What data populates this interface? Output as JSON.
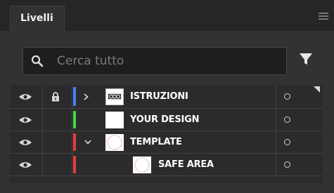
{
  "panel": {
    "tab_label": "Livelli",
    "menu_icon": "hamburger-icon"
  },
  "search": {
    "placeholder": "Cerca tutto",
    "value": "",
    "icon": "search-icon",
    "filter_icon": "filter-icon"
  },
  "layers": [
    {
      "name": "ISTRUZIONI",
      "color": "#4a7dff",
      "visible": true,
      "locked": true,
      "expanded": false,
      "depth": 0,
      "thumbnail": "instructions-thumbnail"
    },
    {
      "name": "YOUR DESIGN",
      "color": "#3ddc3d",
      "visible": true,
      "locked": false,
      "depth": 0,
      "thumbnail": "blank-thumbnail"
    },
    {
      "name": "TEMPLATE",
      "color": "#e53b3b",
      "visible": true,
      "locked": false,
      "expanded": true,
      "depth": 0,
      "thumbnail": "circle-thumbnail"
    },
    {
      "name": "SAFE AREA",
      "color": "#e53b3b",
      "visible": true,
      "locked": false,
      "depth": 1,
      "thumbnail": "circle-thumbnail"
    }
  ],
  "icons": {
    "visibility": "eye-icon",
    "lock": "lock-icon",
    "expand": "chevron-right-icon",
    "collapse": "chevron-down-icon",
    "target": "target-circle-icon"
  }
}
